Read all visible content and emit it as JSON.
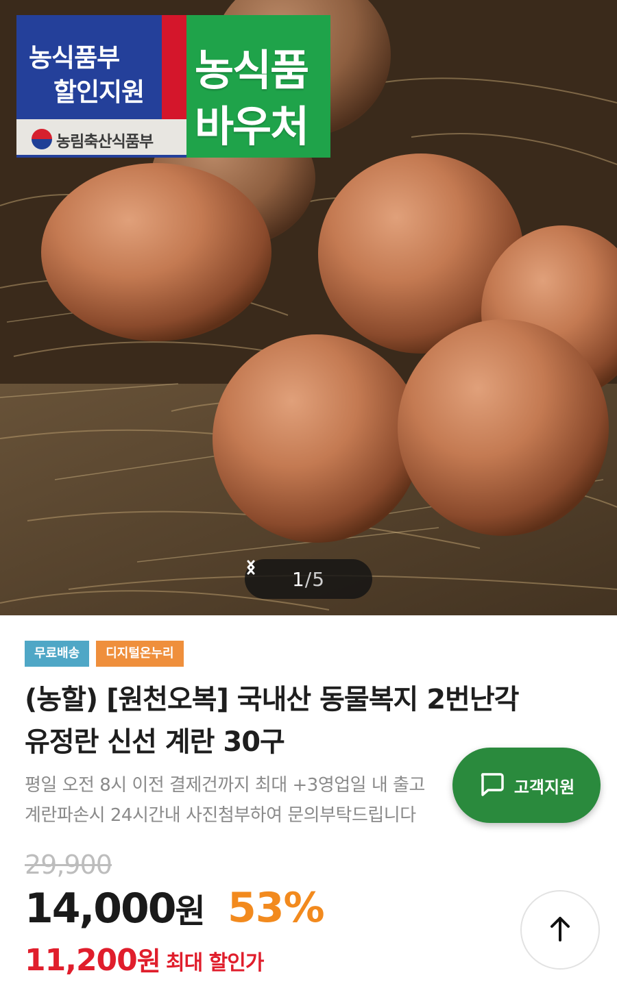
{
  "hero": {
    "voucher_badge": {
      "line1": "농식품부",
      "line2": "할인지원",
      "ministry": "농림축산식품부",
      "green_line1": "농식품",
      "green_line2": "바우처"
    },
    "pager": {
      "current": "1",
      "separator": "/",
      "total": "5",
      "prev_icon": "chevron-left-icon",
      "next_icon": "chevron-right-icon"
    }
  },
  "product": {
    "tags": [
      {
        "label": "무료배송",
        "color": "#4fa7c6"
      },
      {
        "label": "디지털온누리",
        "color": "#ef8f3c"
      }
    ],
    "title_line1": "(농할) [원천오복] 국내산 동물복지 2번난각",
    "title_line2": "유정란 신선 계란 30구",
    "desc_line1": "평일 오전 8시 이전 결제건까지 최대 +3영업일 내 출고",
    "desc_line2": "계란파손시 24시간내 사진첨부하여 문의부탁드립니다",
    "original_price": "29,900",
    "price_value": "14,000",
    "price_unit": "원",
    "discount": "53%",
    "max_price_value": "11,200",
    "max_price_unit": "원",
    "max_label": "최대 할인가"
  },
  "floating": {
    "customer_support_label": "고객지원",
    "customer_support_icon": "chat-bubble-icon",
    "scroll_top_icon": "arrow-up-icon"
  },
  "colors": {
    "support_green": "#2a8a3d",
    "discount_orange": "#f28a1e",
    "max_price_red": "#e01e2c"
  }
}
